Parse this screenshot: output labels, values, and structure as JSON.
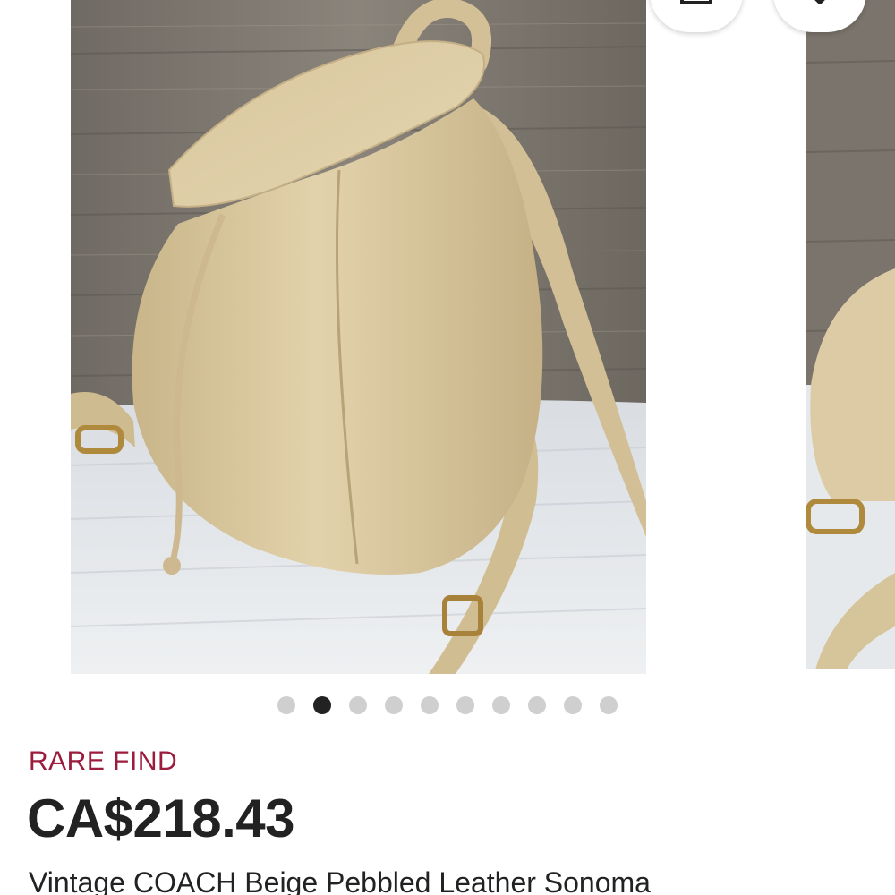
{
  "listing": {
    "badge": "RARE FIND",
    "price": "CA$218.43",
    "title": "Vintage COACH Beige Pebbled Leather Sonoma"
  },
  "carousel": {
    "slide_count": 10,
    "active_index": 1,
    "actions": [
      {
        "name": "cart-icon"
      },
      {
        "name": "tag-icon"
      }
    ]
  },
  "colors": {
    "badge": "#9b1c3c",
    "text": "#222222",
    "dot_active": "#222222",
    "dot_inactive": "#cfcfcf",
    "leather": "#d9c79f",
    "wood": "#7c766e"
  }
}
